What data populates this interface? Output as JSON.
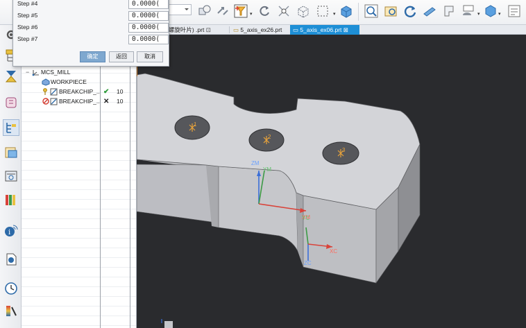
{
  "dialog": {
    "steps": [
      {
        "label": "Step #4",
        "value": "0.0000("
      },
      {
        "label": "Step #5",
        "value": "0.0000("
      },
      {
        "label": "Step #6",
        "value": "0.0000("
      },
      {
        "label": "Step #7",
        "value": "0.0000("
      }
    ],
    "ok_label": "确定",
    "back_label": "返回",
    "cancel_label": "取消"
  },
  "tabs": [
    {
      "label": "(螺旋叶片) .prt",
      "active": false
    },
    {
      "label": "5_axis_ex26.prt",
      "active": false
    },
    {
      "label": "5_axis_ex06.prt",
      "active": true
    }
  ],
  "navigator": {
    "rows": [
      {
        "label": "MCS_MILL",
        "icon": "mcs-icon",
        "status": "",
        "count": ""
      },
      {
        "label": "WORKPIECE",
        "icon": "workpiece-icon",
        "status": "",
        "count": ""
      },
      {
        "label": "BREAKCHIP_...",
        "icon": "operation-icon",
        "status": "check",
        "count": "10"
      },
      {
        "label": "BREAKCHIP_...",
        "icon": "operation-warning-icon",
        "status": "cross",
        "count": "10"
      }
    ]
  },
  "viewport": {
    "hole_labels": [
      "1",
      "2",
      "3"
    ],
    "axis_labels": {
      "zm": "ZM",
      "ym": "YM",
      "xm": "XM",
      "yc": "YC",
      "zc": "ZC",
      "xc": "XC"
    }
  },
  "colors": {
    "accent": "#1e8fd6",
    "viewport_bg": "#2a2b2e",
    "part_face": "#d3d4d8",
    "hole_fill": "#56575b"
  }
}
